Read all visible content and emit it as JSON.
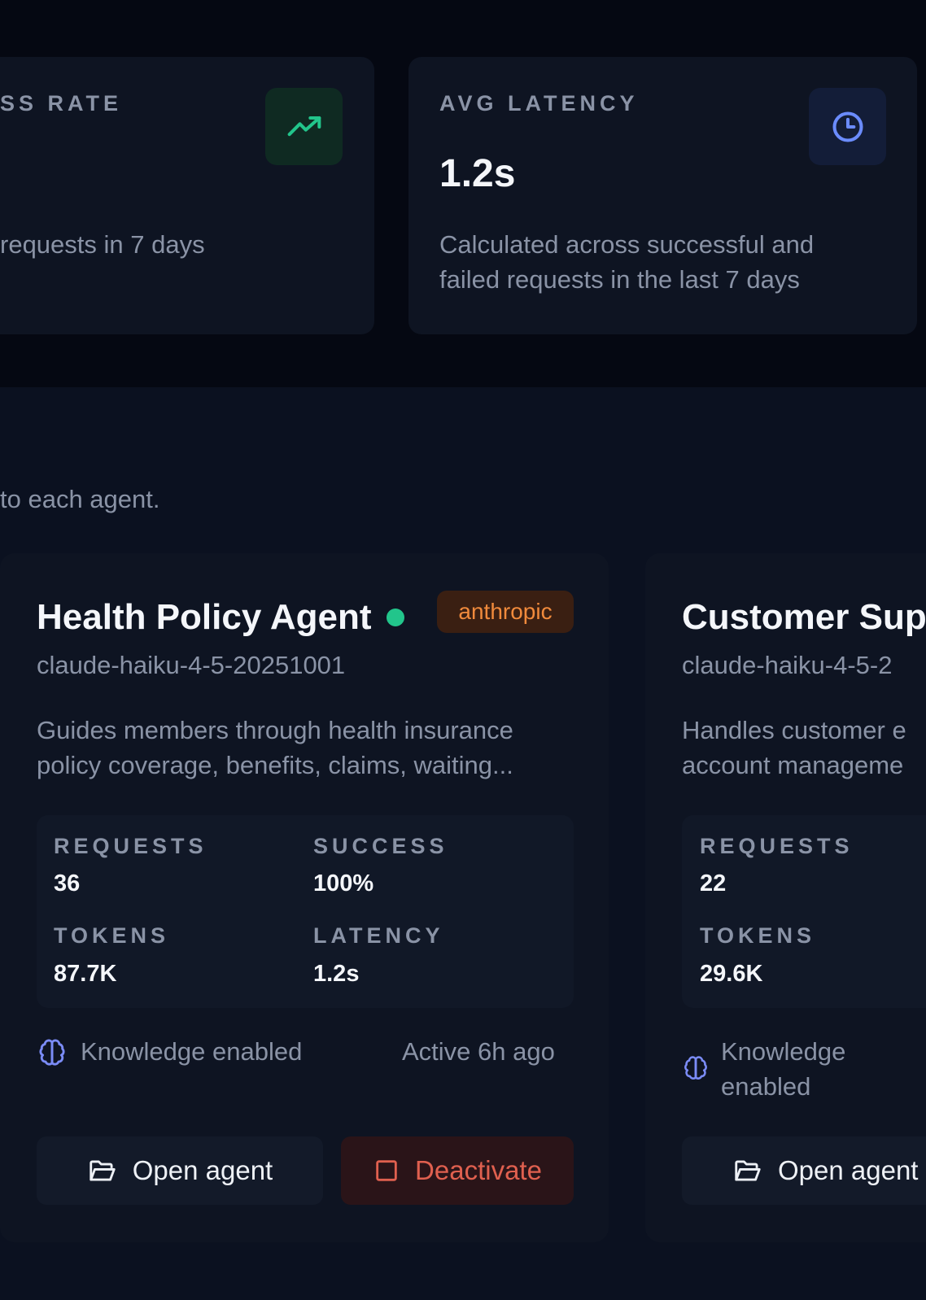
{
  "stats": {
    "success": {
      "label": "SS RATE",
      "desc": "requests in 7 days",
      "icon": "trending-up-icon",
      "accent": "#22c58b"
    },
    "latency": {
      "label": "AVG LATENCY",
      "value": "1.2s",
      "desc": "Calculated across successful and failed requests in the last 7 days",
      "icon": "clock-icon",
      "accent": "#6b8cff"
    }
  },
  "section": {
    "subtitle": "to each agent."
  },
  "agents": [
    {
      "name": "Health Policy Agent",
      "status_color": "#22c58b",
      "provider": "anthropic",
      "model": "claude-haiku-4-5-20251001",
      "description": "Guides members through health insurance policy coverage, benefits, claims, waiting...",
      "metrics": {
        "requests_label": "REQUESTS",
        "requests": "36",
        "success_label": "SUCCESS",
        "success": "100%",
        "tokens_label": "TOKENS",
        "tokens": "87.7K",
        "latency_label": "LATENCY",
        "latency": "1.2s"
      },
      "knowledge": "Knowledge enabled",
      "active": "Active 6h ago",
      "open_label": "Open agent",
      "deactivate_label": "Deactivate"
    },
    {
      "name": "Customer Sup",
      "model": "claude-haiku-4-5-2",
      "description": "Handles customer e account manageme",
      "metrics": {
        "requests_label": "REQUESTS",
        "requests": "22",
        "tokens_label": "TOKENS",
        "tokens": "29.6K"
      },
      "knowledge": "Knowledge enabled",
      "open_label": "Open agent"
    }
  ]
}
